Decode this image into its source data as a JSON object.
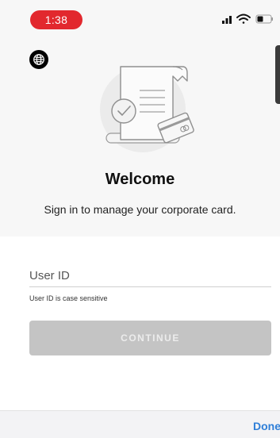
{
  "status_bar": {
    "time": "1:38"
  },
  "welcome": {
    "title": "Welcome",
    "subtitle": "Sign in to manage your corporate card."
  },
  "form": {
    "userid_label": "User ID",
    "userid_value": "",
    "hint": "User ID is case sensitive",
    "continue_label": "CONTINUE"
  },
  "keyboard_bar": {
    "done_label": "Done"
  },
  "colors": {
    "time_pill": "#e2282e",
    "button_disabled": "#c4c4c4",
    "done_link": "#2f7fd8"
  },
  "icons": {
    "language": "globe-icon",
    "illustration": "receipt-card-illustration-icon"
  }
}
